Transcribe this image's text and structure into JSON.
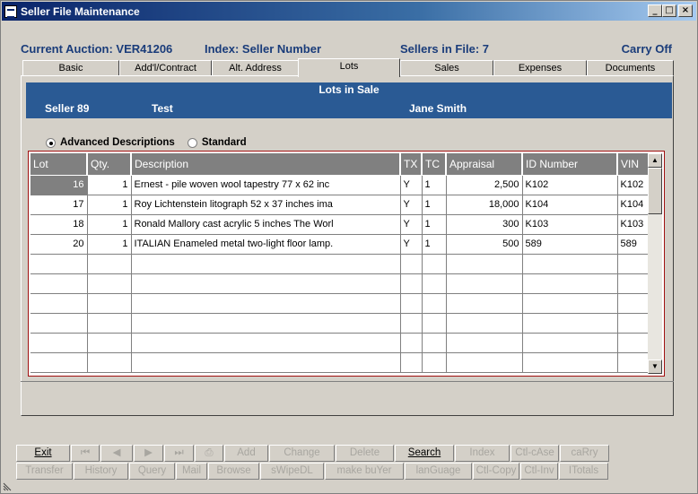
{
  "window": {
    "title": "Seller File Maintenance",
    "minimize": "_",
    "maximize": "□",
    "close": "×"
  },
  "header": {
    "auction": "Current Auction: VER41206",
    "index": "Index: Seller Number",
    "sellers": "Sellers in File: 7",
    "carry": "Carry Off"
  },
  "tabs": [
    "Basic",
    "Add'l/Contract",
    "Alt. Address",
    "Lots",
    "Sales",
    "Expenses",
    "Documents"
  ],
  "active_tab": "Lots",
  "banner": {
    "title": "Lots in Sale",
    "seller": "Seller 89",
    "name1": "Test",
    "name2": "Jane Smith"
  },
  "radios": {
    "advanced": "Advanced Descriptions",
    "standard": "Standard",
    "selected": "advanced"
  },
  "grid": {
    "columns": [
      "Lot",
      "Qty.",
      "Description",
      "TX",
      "TC",
      "Appraisal",
      "ID Number",
      "VIN"
    ],
    "rows": [
      [
        "16",
        "1",
        "Ernest - pile woven wool tapestry 77 x 62 inc",
        "Y",
        "1",
        "2,500",
        "K102",
        "K102"
      ],
      [
        "17",
        "1",
        "Roy Lichtenstein litograph 52 x 37 inches ima",
        "Y",
        "1",
        "18,000",
        "K104",
        "K104"
      ],
      [
        "18",
        "1",
        "Ronald Mallory cast acrylic 5 inches The Worl",
        "Y",
        "1",
        "300",
        "K103",
        "K103"
      ],
      [
        "20",
        "1",
        "ITALIAN Enameled metal two-light floor lamp.",
        "Y",
        "1",
        "500",
        "589",
        "589"
      ]
    ],
    "empty_rows": 6,
    "scroll_up": "▲",
    "scroll_down": "▼"
  },
  "buttons_row1": [
    {
      "label": "Exit",
      "enabled": true,
      "w": 60
    },
    {
      "label": "⏮",
      "enabled": false,
      "w": 32
    },
    {
      "label": "◀",
      "enabled": false,
      "w": 36
    },
    {
      "label": "▶",
      "enabled": false,
      "w": 33
    },
    {
      "label": "⏭",
      "enabled": false,
      "w": 33
    },
    {
      "label": "⎙",
      "enabled": false,
      "w": 32
    },
    {
      "label": "Add",
      "enabled": false,
      "w": 49
    },
    {
      "label": "Change",
      "enabled": false,
      "w": 73
    },
    {
      "label": "Delete",
      "enabled": false,
      "w": 65
    },
    {
      "label": "Search",
      "enabled": true,
      "w": 66
    },
    {
      "label": "Index",
      "enabled": false,
      "w": 61
    },
    {
      "label": "Ctl-cAse",
      "enabled": false,
      "w": 54
    },
    {
      "label": "caRry",
      "enabled": false,
      "w": 55
    }
  ],
  "buttons_row2": [
    {
      "label": "Transfer",
      "enabled": false,
      "w": 63
    },
    {
      "label": "History",
      "enabled": false,
      "w": 61
    },
    {
      "label": "Query",
      "enabled": false,
      "w": 51
    },
    {
      "label": "Mail",
      "enabled": false,
      "w": 35
    },
    {
      "label": "Browse",
      "enabled": false,
      "w": 57
    },
    {
      "label": "sWipeDL",
      "enabled": false,
      "w": 71
    },
    {
      "label": "make buYer",
      "enabled": false,
      "w": 88
    },
    {
      "label": "lanGuage",
      "enabled": false,
      "w": 75
    },
    {
      "label": "Ctl-Copy",
      "enabled": false,
      "w": 52
    },
    {
      "label": "Ctl-Inv",
      "enabled": false,
      "w": 42
    },
    {
      "label": "ITotals",
      "enabled": false,
      "w": 55
    }
  ]
}
